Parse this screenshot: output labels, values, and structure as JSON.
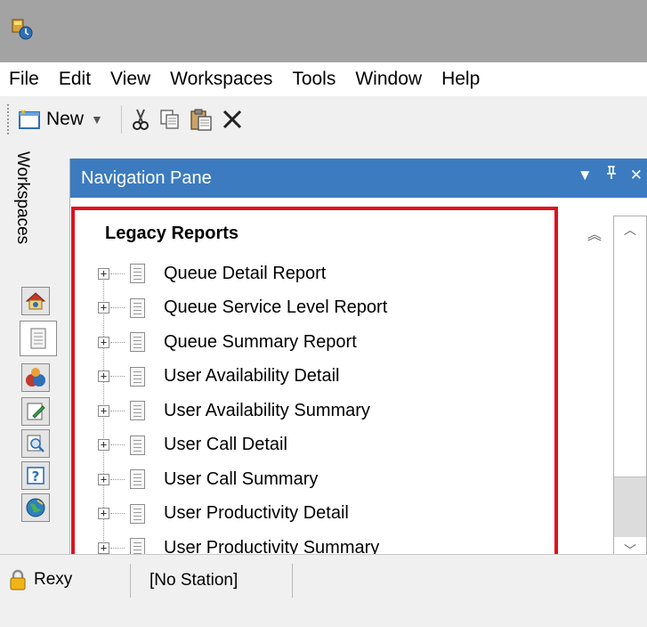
{
  "menu": [
    "File",
    "Edit",
    "View",
    "Workspaces",
    "Tools",
    "Window",
    "Help"
  ],
  "toolbar": {
    "new_label": "New",
    "icons": [
      "new-icon",
      "dropdown-arrow-icon",
      "cut-icon",
      "copy-icon",
      "paste-icon",
      "delete-icon"
    ]
  },
  "workspaces": {
    "label": "Workspaces",
    "tabs": [
      "home-icon",
      "reports-icon",
      "users-icon",
      "edit-icon",
      "search-icon",
      "help-icon",
      "globe-icon"
    ]
  },
  "nav_pane": {
    "title": "Navigation Pane",
    "controls": [
      "dropdown-icon",
      "pin-icon",
      "close-icon"
    ],
    "section_title": "Legacy Reports",
    "items": [
      "Queue Detail Report",
      "Queue Service Level Report",
      "Queue Summary Report",
      "User Availability Detail",
      "User Availability Summary",
      "User Call Detail",
      "User Call Summary",
      "User Productivity Detail",
      "User Productivity Summary"
    ]
  },
  "status": {
    "user": "Rexy",
    "station": "[No Station]"
  },
  "colors": {
    "header_blue": "#3c7bbf",
    "highlight_red": "#e0101c",
    "titlebar_gray": "#a3a3a3"
  }
}
